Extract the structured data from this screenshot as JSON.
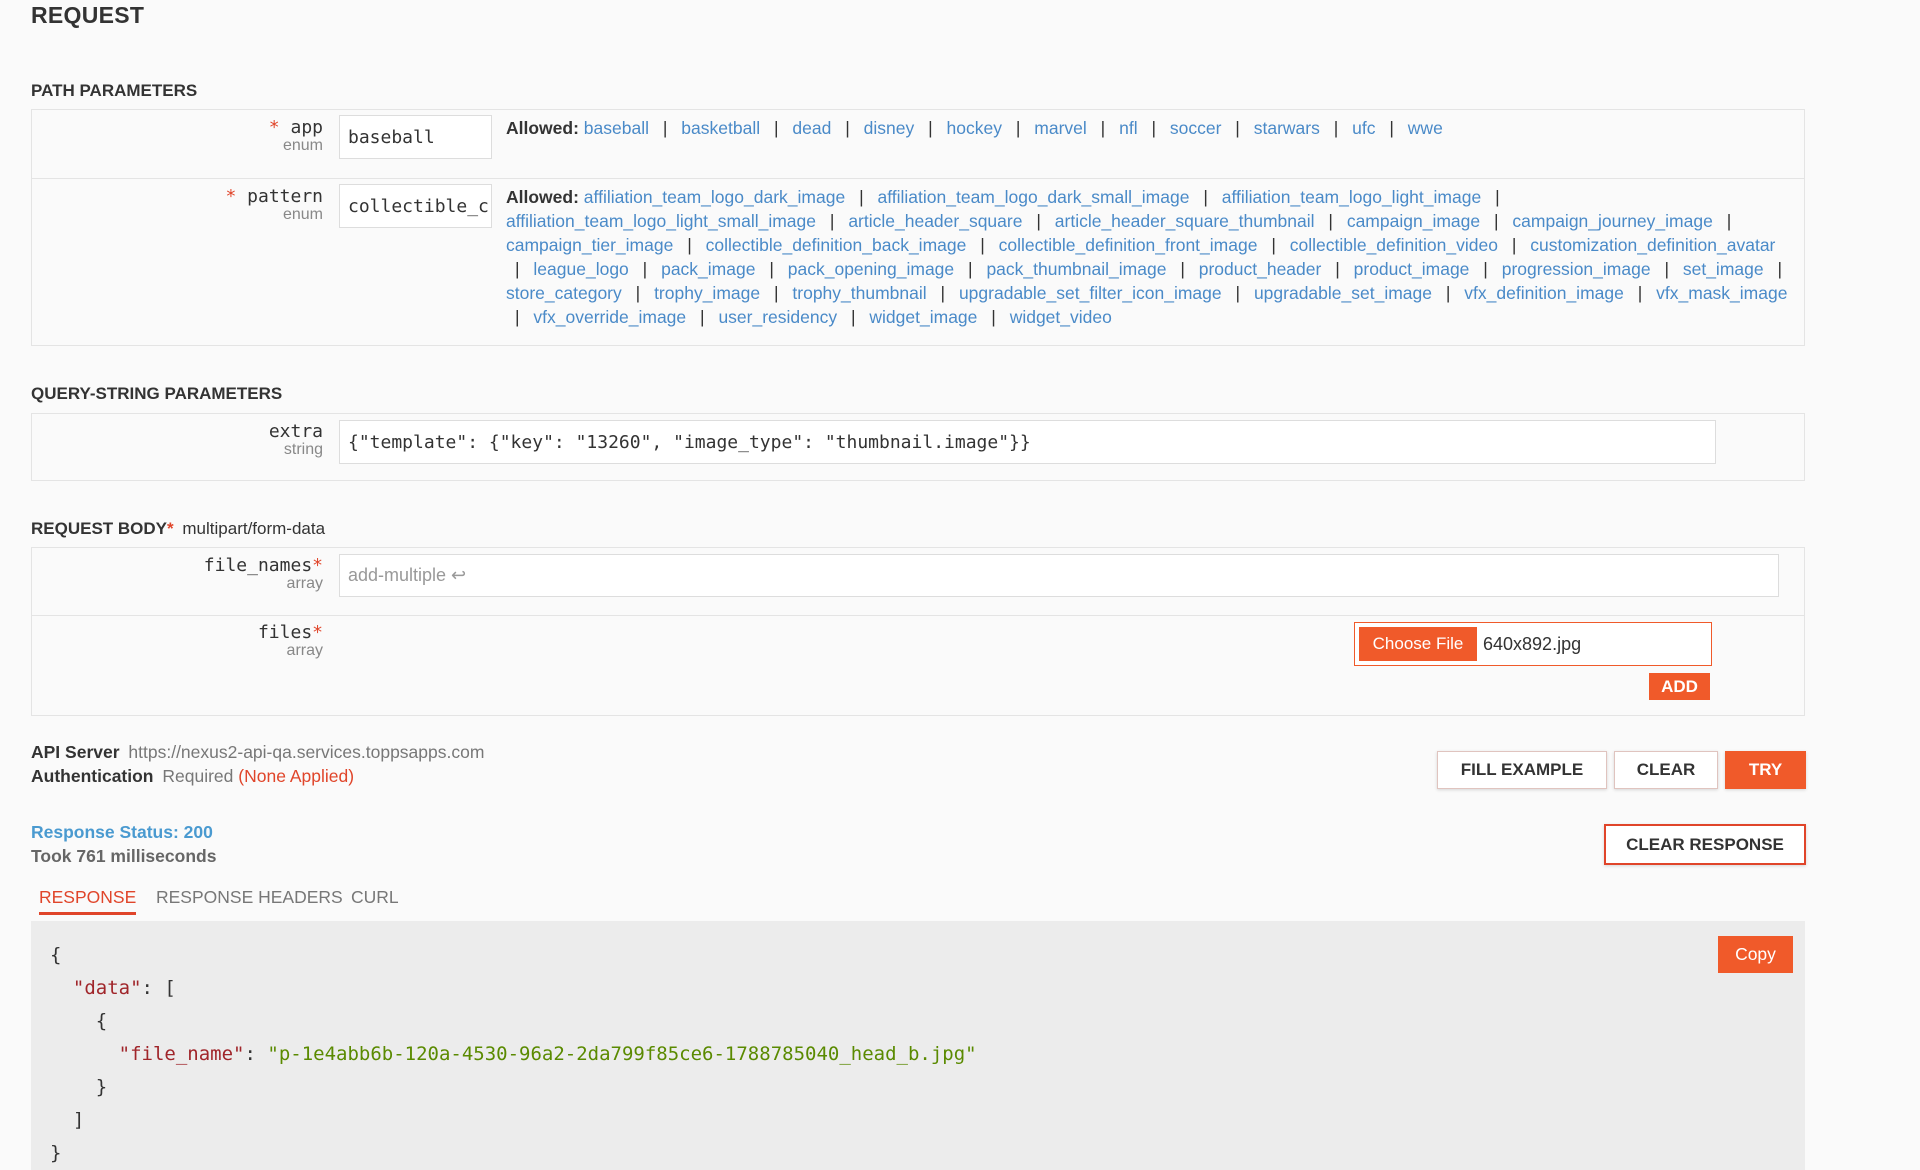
{
  "title": "REQUEST",
  "path_params": {
    "heading": "PATH PARAMETERS",
    "app": {
      "name": "app",
      "type": "enum",
      "value": "baseball",
      "allowed_label": "Allowed:",
      "allowed": [
        "baseball",
        "basketball",
        "dead",
        "disney",
        "hockey",
        "marvel",
        "nfl",
        "soccer",
        "starwars",
        "ufc",
        "wwe"
      ]
    },
    "pattern": {
      "name": "pattern",
      "type": "enum",
      "value": "collectible_c",
      "allowed_label": "Allowed:",
      "allowed": [
        "affiliation_team_logo_dark_image",
        "affiliation_team_logo_dark_small_image",
        "affiliation_team_logo_light_image",
        "affiliation_team_logo_light_small_image",
        "article_header_square",
        "article_header_square_thumbnail",
        "campaign_image",
        "campaign_journey_image",
        "campaign_tier_image",
        "collectible_definition_back_image",
        "collectible_definition_front_image",
        "collectible_definition_video",
        "customization_definition_avatar",
        "league_logo",
        "pack_image",
        "pack_opening_image",
        "pack_thumbnail_image",
        "product_header",
        "product_image",
        "progression_image",
        "set_image",
        "store_category",
        "trophy_image",
        "trophy_thumbnail",
        "upgradable_set_filter_icon_image",
        "upgradable_set_image",
        "vfx_definition_image",
        "vfx_mask_image",
        "vfx_override_image",
        "user_residency",
        "widget_image",
        "widget_video"
      ]
    }
  },
  "query_params": {
    "heading": "QUERY-STRING PARAMETERS",
    "extra": {
      "name": "extra",
      "type": "string",
      "value": "{\"template\": {\"key\": \"13260\", \"image_type\": \"thumbnail.image\"}}"
    }
  },
  "request_body": {
    "heading": "REQUEST BODY",
    "required_mark": "*",
    "content_type": "multipart/form-data",
    "file_names": {
      "name": "file_names",
      "type": "array",
      "placeholder": "add-multiple ↩"
    },
    "files": {
      "name": "files",
      "type": "array",
      "choose_label": "Choose File",
      "file_name": "640x892.jpg",
      "add_label": "ADD"
    }
  },
  "server": {
    "label": "API Server",
    "url": "https://nexus2-api-qa.services.toppsapps.com",
    "auth_label": "Authentication",
    "auth_value": "Required",
    "auth_status": "(None Applied)"
  },
  "actions": {
    "fill_example": "FILL EXAMPLE",
    "clear": "CLEAR",
    "try": "TRY",
    "clear_response": "CLEAR RESPONSE"
  },
  "response": {
    "status": "Response Status: 200",
    "took": "Took 761 milliseconds",
    "tabs": [
      "RESPONSE",
      "RESPONSE HEADERS",
      "CURL"
    ],
    "copy_label": "Copy",
    "key_data": "\"data\"",
    "key_file_name": "\"file_name\"",
    "value_file_name": "\"p-1e4abb6b-120a-4530-96a2-2da799f85ce6-1788785040_head_b.jpg\""
  },
  "colors": {
    "accent": "#f05a2a",
    "link": "#4a8ac8",
    "status": "#4a9ad0",
    "required": "#e0452a"
  }
}
